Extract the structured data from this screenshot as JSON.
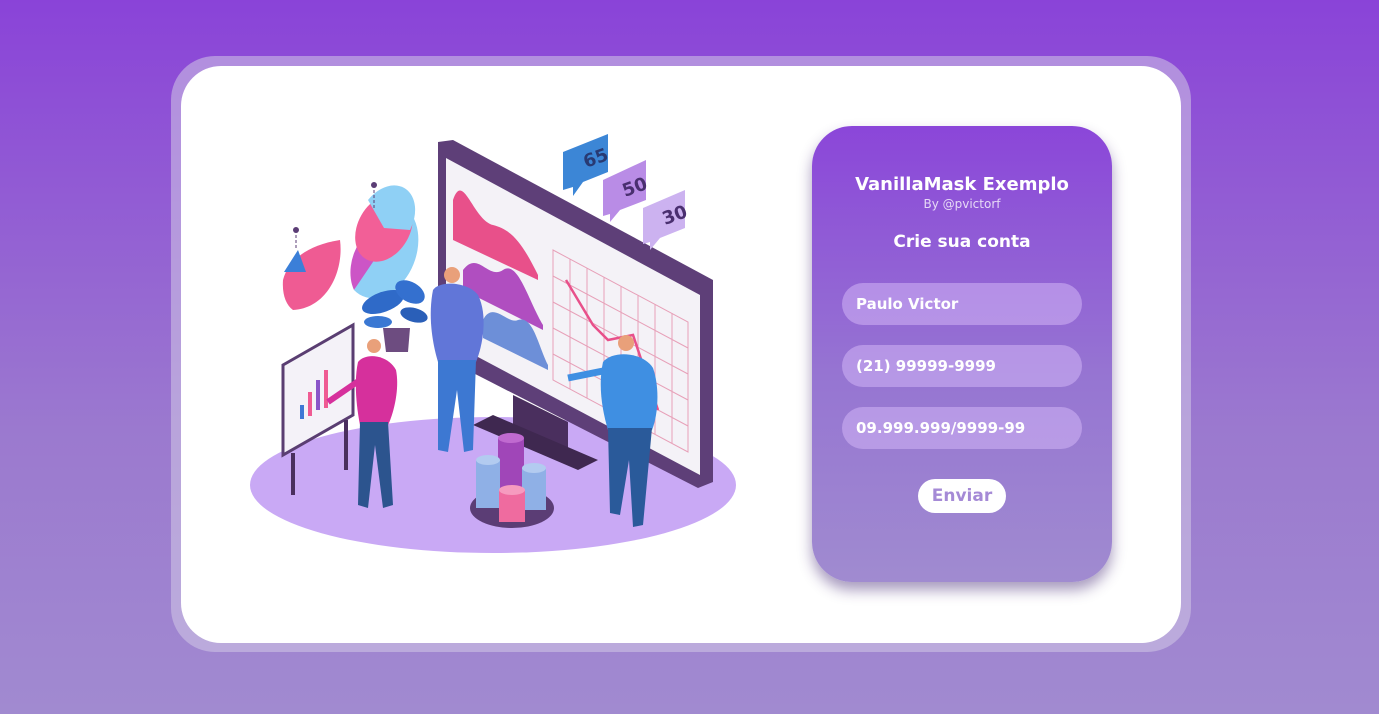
{
  "form": {
    "title": "VanillaMask Exemplo",
    "author": "By @pvictorf",
    "subtitle": "Crie sua conta",
    "fields": [
      {
        "value": "Paulo Victor"
      },
      {
        "value": "(21) 99999-9999"
      },
      {
        "value": "09.999.999/9999-99"
      }
    ],
    "submit_label": "Enviar"
  },
  "illustration": {
    "bubbles": [
      "65",
      "50",
      "30"
    ]
  },
  "colors": {
    "background_top": "#8a43d8",
    "background_bottom": "#a18ad0",
    "card": "#ffffff",
    "panel_top": "#8b46d9",
    "panel_bottom": "#a08bd0",
    "button_text": "#a58ad6"
  }
}
